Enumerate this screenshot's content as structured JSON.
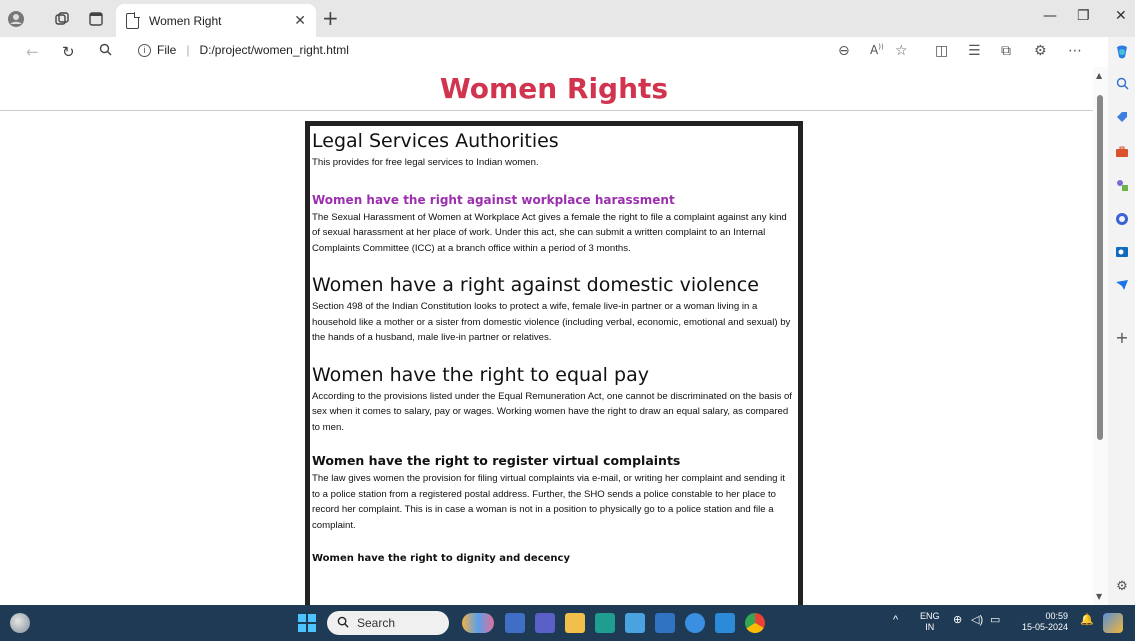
{
  "browser": {
    "tab_title": "Women Right",
    "url_scheme_label": "File",
    "url_path": "D:/project/women_right.html"
  },
  "page": {
    "heading": "Women Rights",
    "sections": [
      {
        "title": "Legal Services Authorities",
        "body": "This provides for free legal services to Indian women."
      },
      {
        "title": "Women have the right against workplace harassment",
        "body": "The Sexual Harassment of Women at Workplace Act gives a female the right to file a complaint against any kind of sexual harassment at her place of work. Under this act, she can submit a written complaint to an Internal Complaints Committee (ICC) at a branch office within a period of 3 months."
      },
      {
        "title": "Women have a right against domestic violence",
        "body": "Section 498 of the Indian Constitution looks to protect a wife, female live-in partner or a woman living in a household like a mother or a sister from domestic violence (including verbal, economic, emotional and sexual) by the hands of a husband, male live-in partner or relatives."
      },
      {
        "title": "Women have the right to equal pay",
        "body": "According to the provisions listed under the Equal Remuneration Act, one cannot be discriminated on the basis of sex when it comes to salary, pay or wages. Working women have the right to draw an equal salary, as compared to men."
      },
      {
        "title": "Women have the right to register virtual complaints",
        "body": "The law gives women the provision for filing virtual complaints via e-mail, or writing her complaint and sending it to a police station from a registered postal address. Further, the SHO sends a police constable to her place to record her complaint. This is in case a woman is not in a position to physically go to a police station and file a complaint."
      },
      {
        "title": "Women have the right to dignity and decency",
        "body": ""
      }
    ]
  },
  "taskbar": {
    "search_placeholder": "Search",
    "lang_top": "ENG",
    "lang_bottom": "IN",
    "time": "00:59",
    "date": "15-05-2024"
  },
  "colors": {
    "heading": "#d1344e",
    "purple_subheading": "#9b2fae",
    "taskbar": "#1e3a54"
  }
}
